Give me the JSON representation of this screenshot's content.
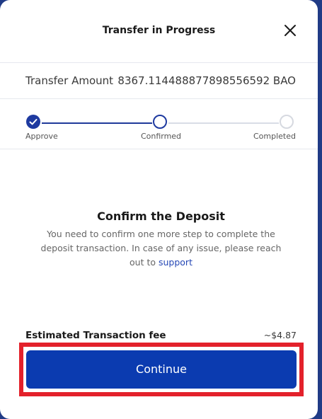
{
  "modal": {
    "title": "Transfer in Progress",
    "close_icon": "close-icon"
  },
  "amount": {
    "label": "Transfer Amount",
    "value": "8367.114488877898556592 BAO"
  },
  "stepper": {
    "steps": [
      {
        "label": "Approve",
        "state": "done",
        "icon": "check-icon"
      },
      {
        "label": "Confirmed",
        "state": "active"
      },
      {
        "label": "Completed",
        "state": "pending"
      }
    ]
  },
  "confirm": {
    "title": "Confirm the Deposit",
    "text": "You need to confirm one more step to complete the deposit transaction. In case of any issue, please reach out to",
    "link": "support"
  },
  "fee": {
    "label": "Estimated Transaction fee",
    "value": "~$4.87"
  },
  "actions": {
    "continue_label": "Continue"
  },
  "colors": {
    "accent": "#0b3bb0",
    "highlight": "#e3212b"
  }
}
